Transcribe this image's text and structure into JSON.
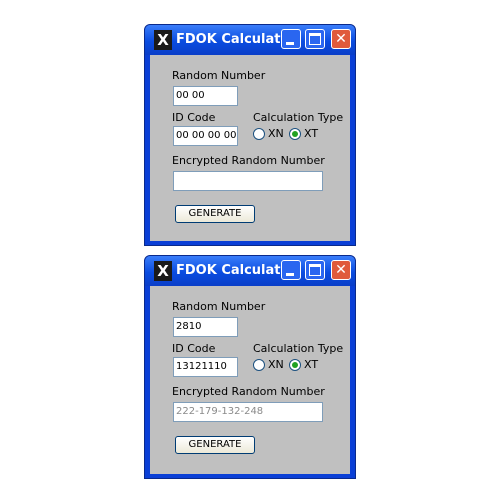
{
  "windows": [
    {
      "title": "FDOK Calculator",
      "icon": "x-logo-icon",
      "close_glyph": "✕",
      "random_number_label": "Random Number",
      "random_number_value": "00 00",
      "id_code_label": "ID Code",
      "id_code_value": "00 00 00 00",
      "calc_type_label": "Calculation Type",
      "option_xn": "XN",
      "option_xt": "XT",
      "selected_type": "XT",
      "encrypted_label": "Encrypted Random Number",
      "encrypted_value": "",
      "generate_label": "GENERATE"
    },
    {
      "title": "FDOK Calculator",
      "icon": "x-logo-icon",
      "close_glyph": "✕",
      "random_number_label": "Random Number",
      "random_number_value": "2810",
      "id_code_label": "ID Code",
      "id_code_value": "13121110",
      "calc_type_label": "Calculation Type",
      "option_xn": "XN",
      "option_xt": "XT",
      "selected_type": "XT",
      "encrypted_label": "Encrypted Random Number",
      "encrypted_value": "222-179-132-248",
      "generate_label": "GENERATE"
    }
  ],
  "colors": {
    "title_bar": "#0a4ce0",
    "window_border": "#0a3fd6",
    "client_bg": "#c0c0c0",
    "close_button": "#e05a3b",
    "radio_selected": "#21a121"
  }
}
